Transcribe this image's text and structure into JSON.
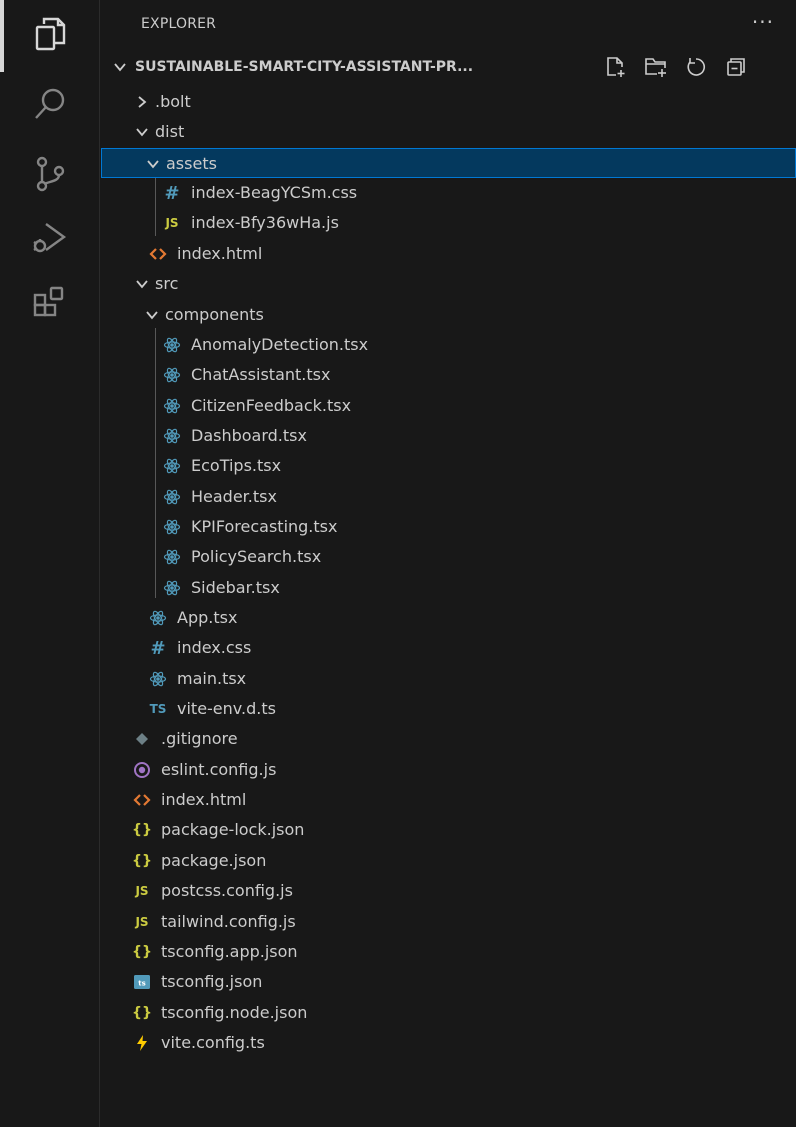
{
  "explorer": {
    "title": "EXPLORER",
    "more_label": "···",
    "project_name": "SUSTAINABLE-SMART-CITY-ASSISTANT-PR..."
  },
  "activity_bar": {
    "items": [
      "files-icon",
      "search-icon",
      "source-control-icon",
      "run-debug-icon",
      "extensions-icon"
    ]
  },
  "tree": [
    {
      "label": ".bolt",
      "kind": "folder",
      "expanded": false,
      "depth": 0
    },
    {
      "label": "dist",
      "kind": "folder",
      "expanded": true,
      "depth": 0
    },
    {
      "label": "assets",
      "kind": "folder",
      "expanded": true,
      "depth": 1,
      "selected": true
    },
    {
      "label": "index-BeagYCSm.css",
      "kind": "css",
      "depth": 2
    },
    {
      "label": "index-Bfy36wHa.js",
      "kind": "js",
      "depth": 2
    },
    {
      "label": "index.html",
      "kind": "html",
      "depth": 1
    },
    {
      "label": "src",
      "kind": "folder",
      "expanded": true,
      "depth": 0
    },
    {
      "label": "components",
      "kind": "folder",
      "expanded": true,
      "depth": 1
    },
    {
      "label": "AnomalyDetection.tsx",
      "kind": "react",
      "depth": 2
    },
    {
      "label": "ChatAssistant.tsx",
      "kind": "react",
      "depth": 2
    },
    {
      "label": "CitizenFeedback.tsx",
      "kind": "react",
      "depth": 2
    },
    {
      "label": "Dashboard.tsx",
      "kind": "react",
      "depth": 2
    },
    {
      "label": "EcoTips.tsx",
      "kind": "react",
      "depth": 2
    },
    {
      "label": "Header.tsx",
      "kind": "react",
      "depth": 2
    },
    {
      "label": "KPIForecasting.tsx",
      "kind": "react",
      "depth": 2
    },
    {
      "label": "PolicySearch.tsx",
      "kind": "react",
      "depth": 2
    },
    {
      "label": "Sidebar.tsx",
      "kind": "react",
      "depth": 2
    },
    {
      "label": "App.tsx",
      "kind": "react",
      "depth": 1
    },
    {
      "label": "index.css",
      "kind": "css",
      "depth": 1
    },
    {
      "label": "main.tsx",
      "kind": "react",
      "depth": 1
    },
    {
      "label": "vite-env.d.ts",
      "kind": "ts",
      "depth": 1
    },
    {
      "label": ".gitignore",
      "kind": "git",
      "depth": 0
    },
    {
      "label": "eslint.config.js",
      "kind": "eslint",
      "depth": 0
    },
    {
      "label": "index.html",
      "kind": "html",
      "depth": 0
    },
    {
      "label": "package-lock.json",
      "kind": "json",
      "depth": 0
    },
    {
      "label": "package.json",
      "kind": "json",
      "depth": 0
    },
    {
      "label": "postcss.config.js",
      "kind": "js",
      "depth": 0
    },
    {
      "label": "tailwind.config.js",
      "kind": "js",
      "depth": 0
    },
    {
      "label": "tsconfig.app.json",
      "kind": "json",
      "depth": 0
    },
    {
      "label": "tsconfig.json",
      "kind": "tsconfig",
      "depth": 0
    },
    {
      "label": "tsconfig.node.json",
      "kind": "json",
      "depth": 0
    },
    {
      "label": "vite.config.ts",
      "kind": "vite",
      "depth": 0
    }
  ],
  "colors": {
    "css": "#519aba",
    "js": "#cbcb41",
    "html": "#e37933",
    "react": "#519aba",
    "ts": "#519aba",
    "json": "#cbcb41",
    "git": "#6d8086",
    "eslint": "#a074c4",
    "vite": "#ffcc00",
    "tsconfig": "#519aba"
  }
}
